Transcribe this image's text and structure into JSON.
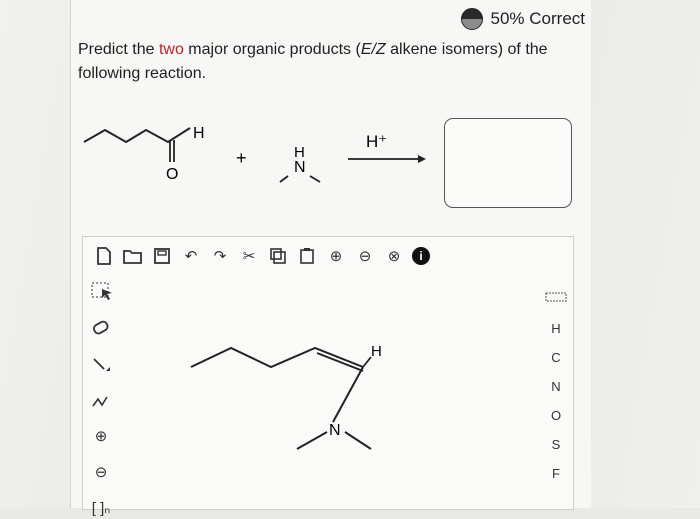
{
  "score": {
    "text": "50% Correct"
  },
  "question": {
    "p1": "Predict the ",
    "highlight": "two",
    "p2": " major organic products (",
    "ez": "E/Z",
    "p3": " alkene isomers) of the following reaction."
  },
  "reaction": {
    "aldehyde_h": "H",
    "aldehyde_o": "O",
    "plus": "+",
    "amine_h": "H",
    "amine_n": "N",
    "catalyst": "H⁺"
  },
  "toolbar": {
    "undo": "↶",
    "redo": "↷",
    "cut": "✂",
    "zoom_in": "⊕",
    "zoom_out": "⊖",
    "close": "⊗",
    "info": "i"
  },
  "lefttools": {
    "plus": "⊕",
    "minus": "⊖",
    "bracket": "[ ]ₙ"
  },
  "elements": [
    "H",
    "C",
    "N",
    "O",
    "S",
    "F"
  ],
  "drawing": {
    "h": "H",
    "n": "N"
  }
}
